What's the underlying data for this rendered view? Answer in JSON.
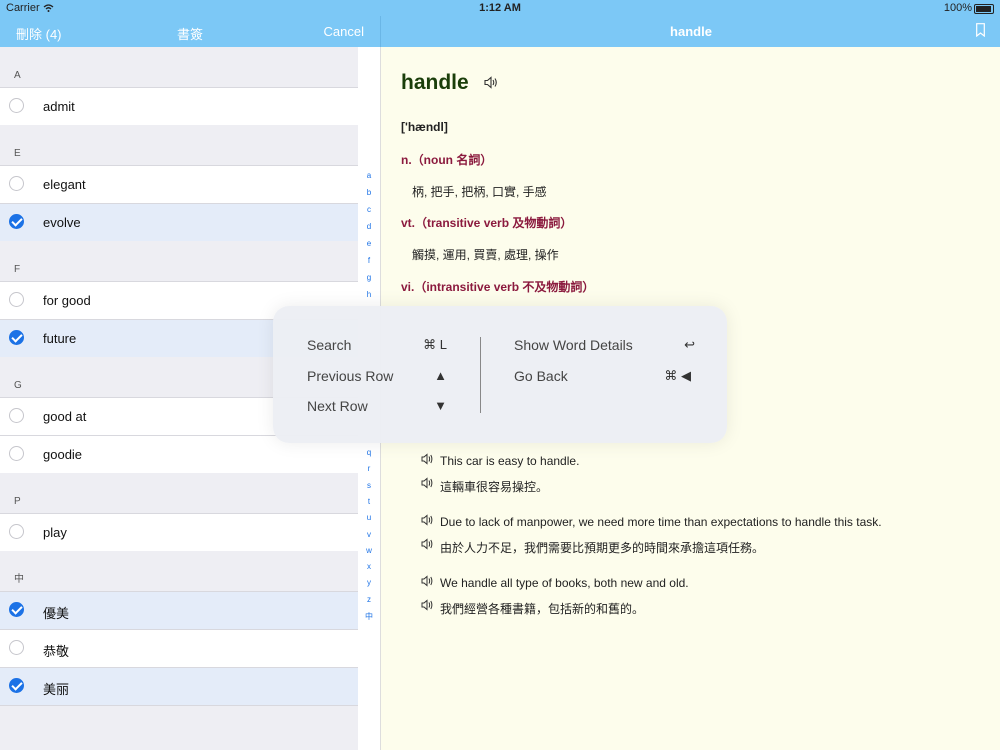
{
  "status": {
    "carrier": "Carrier",
    "time": "1:12 AM",
    "battery": "100%"
  },
  "left_nav": {
    "delete_label": "刪除 (4)",
    "title": "書簽",
    "cancel_label": "Cancel"
  },
  "right_nav": {
    "title": "handle"
  },
  "sections": [
    {
      "header": "A",
      "items": [
        {
          "word": "admit",
          "selected": false
        }
      ]
    },
    {
      "header": "E",
      "items": [
        {
          "word": "elegant",
          "selected": false
        },
        {
          "word": "evolve",
          "selected": true
        }
      ]
    },
    {
      "header": "F",
      "items": [
        {
          "word": "for good",
          "selected": false
        },
        {
          "word": "future",
          "selected": true
        }
      ]
    },
    {
      "header": "G",
      "items": [
        {
          "word": "good at",
          "selected": false
        },
        {
          "word": "goodie",
          "selected": false
        }
      ]
    },
    {
      "header": "P",
      "items": [
        {
          "word": "play",
          "selected": false
        }
      ]
    },
    {
      "header": "中",
      "items": [
        {
          "word": "優美",
          "selected": true
        },
        {
          "word": "恭敬",
          "selected": false
        },
        {
          "word": "美丽",
          "selected": true
        }
      ]
    }
  ],
  "index_top": [
    "a",
    "b",
    "c",
    "d",
    "e",
    "f",
    "g",
    "h"
  ],
  "index_bottom": [
    "q",
    "r",
    "s",
    "t",
    "u",
    "v",
    "w",
    "x",
    "y",
    "z",
    "中"
  ],
  "detail": {
    "word": "handle",
    "phonetic": "['hændl]",
    "pos1": "n.（noun 名詞）",
    "def1": "柄, 把手, 把柄, 口實, 手感",
    "pos2": "vt.（transitive verb 及物動詞）",
    "def2": "觸摸, 運用, 買賣, 處理, 操作",
    "pos3": "vi.（intransitive verb 不及物動詞）",
    "examples": [
      {
        "en": "This car is easy to handle.",
        "zh": "這輛車很容易操控。"
      },
      {
        "en": "Due to lack of manpower, we need more time than expectations to handle this task.",
        "zh": "由於人力不足，我們需要比預期更多的時間來承擔這項任務。"
      },
      {
        "en": "We handle all type of books, both new and old.",
        "zh": "我們經營各種書籍，包括新的和舊的。"
      }
    ]
  },
  "shortcuts": {
    "left": [
      {
        "label": "Search",
        "key": "⌘ L"
      },
      {
        "label": "Previous Row",
        "key": "▲"
      },
      {
        "label": "Next Row",
        "key": "▼"
      }
    ],
    "right": [
      {
        "label": "Show Word Details",
        "key": "↩"
      },
      {
        "label": "Go Back",
        "key": "⌘ ◀"
      }
    ]
  }
}
